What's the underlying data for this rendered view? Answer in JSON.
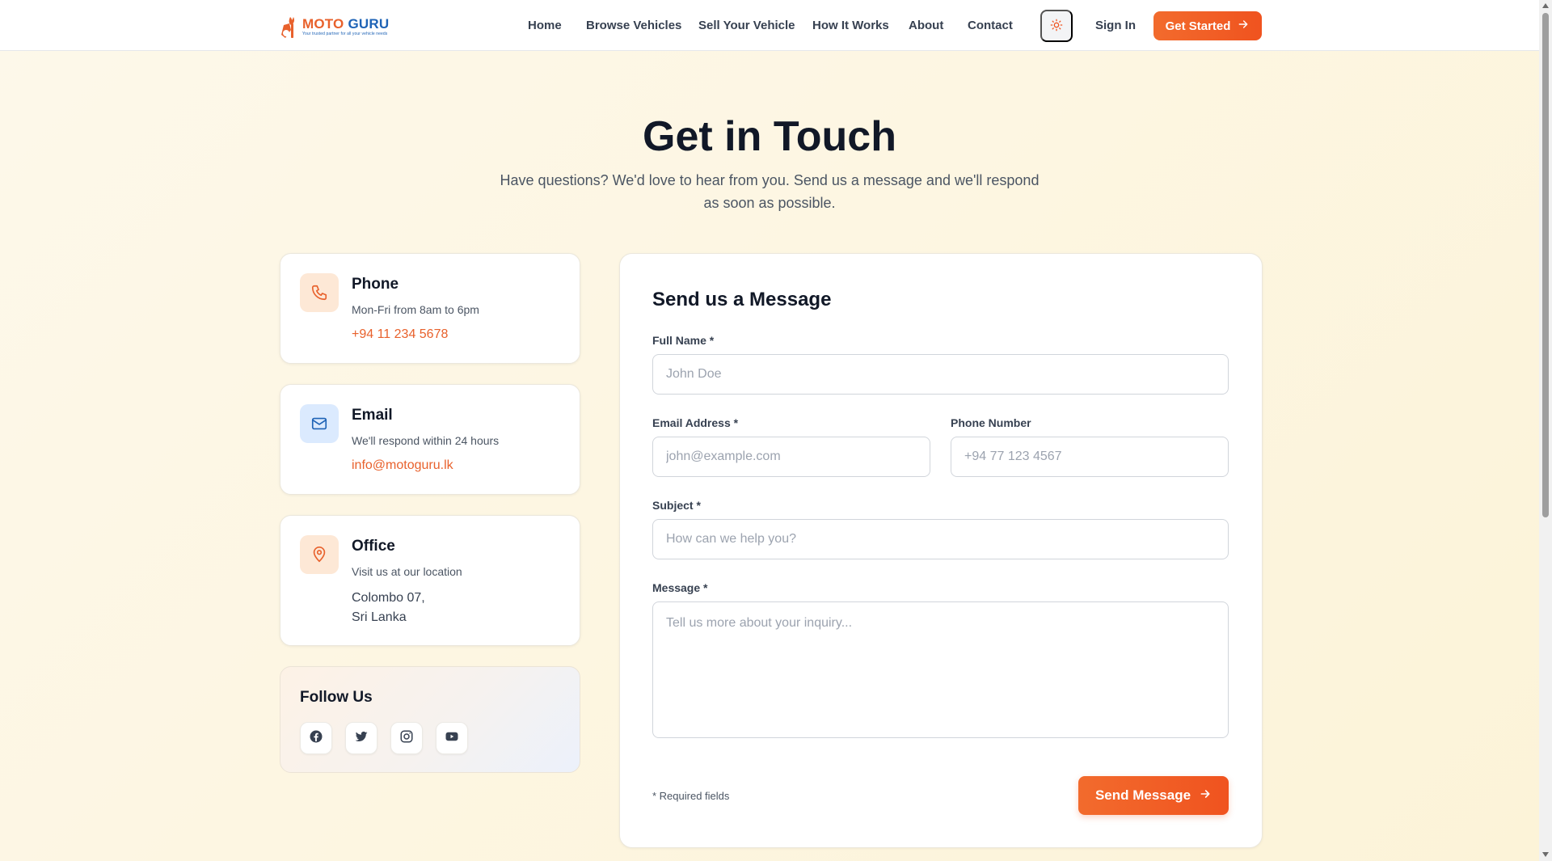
{
  "brand": {
    "name_part1": "MOTO",
    "name_part2": "GURU",
    "tagline": "Your trusted partner for all your vehicle needs"
  },
  "nav": {
    "items": [
      "Home",
      "Browse Vehicles",
      "Sell Your Vehicle",
      "How It Works",
      "About",
      "Contact"
    ],
    "theme_icon": "sun-icon",
    "sign_in": "Sign In",
    "get_started": "Get Started"
  },
  "hero": {
    "title": "Get in Touch",
    "subtitle": "Have questions? We'd love to hear from you. Send us a message and we'll respond as soon as possible."
  },
  "contact_cards": {
    "phone": {
      "title": "Phone",
      "subtitle": "Mon-Fri from 8am to 6pm",
      "value": "+94 11 234 5678",
      "icon": "phone-icon"
    },
    "email": {
      "title": "Email",
      "subtitle": "We'll respond within 24 hours",
      "value": "info@motoguru.lk",
      "icon": "mail-icon"
    },
    "office": {
      "title": "Office",
      "subtitle": "Visit us at our location",
      "address_line1": "Colombo 07,",
      "address_line2": "Sri Lanka",
      "icon": "map-pin-icon"
    }
  },
  "follow": {
    "title": "Follow Us",
    "icons": [
      "facebook-icon",
      "twitter-icon",
      "instagram-icon",
      "youtube-icon"
    ]
  },
  "form": {
    "title": "Send us a Message",
    "full_name_label": "Full Name *",
    "full_name_placeholder": "John Doe",
    "email_label": "Email Address *",
    "email_placeholder": "john@example.com",
    "phone_label": "Phone Number",
    "phone_placeholder": "+94 77 123 4567",
    "subject_label": "Subject *",
    "subject_placeholder": "How can we help you?",
    "message_label": "Message *",
    "message_placeholder": "Tell us more about your inquiry...",
    "required_note": "* Required fields",
    "submit_label": "Send Message"
  },
  "colors": {
    "accent": "#f0531f",
    "brand_orange": "#e8612c",
    "brand_blue": "#1e63b6",
    "phone_icon_bg": "#fde8d6",
    "email_icon_bg": "#dbeafe",
    "office_icon_bg": "#fde8d6"
  }
}
